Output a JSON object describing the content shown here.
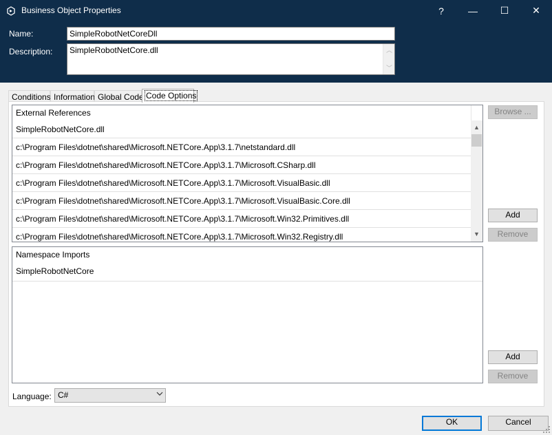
{
  "window": {
    "title": "Business Object Properties",
    "controls": {
      "help": "?",
      "minimize": "—",
      "maximize": "☐",
      "close": "✕"
    }
  },
  "fields": {
    "name_label": "Name:",
    "name_value": "SimpleRobotNetCoreDll",
    "description_label": "Description:",
    "description_value": "SimpleRobotNetCore.dll"
  },
  "tabs": [
    "Conditions",
    "Information",
    "Global Code",
    "Code Options"
  ],
  "active_tab": "Code Options",
  "external_references": {
    "header": "External References",
    "items": [
      "SimpleRobotNetCore.dll",
      "c:\\Program Files\\dotnet\\shared\\Microsoft.NETCore.App\\3.1.7\\netstandard.dll",
      "c:\\Program Files\\dotnet\\shared\\Microsoft.NETCore.App\\3.1.7\\Microsoft.CSharp.dll",
      "c:\\Program Files\\dotnet\\shared\\Microsoft.NETCore.App\\3.1.7\\Microsoft.VisualBasic.dll",
      "c:\\Program Files\\dotnet\\shared\\Microsoft.NETCore.App\\3.1.7\\Microsoft.VisualBasic.Core.dll",
      "c:\\Program Files\\dotnet\\shared\\Microsoft.NETCore.App\\3.1.7\\Microsoft.Win32.Primitives.dll",
      "c:\\Program Files\\dotnet\\shared\\Microsoft.NETCore.App\\3.1.7\\Microsoft.Win32.Registry.dll"
    ],
    "browse_label": "Browse ...",
    "add_label": "Add",
    "remove_label": "Remove"
  },
  "namespace_imports": {
    "header": "Namespace Imports",
    "items": [
      "SimpleRobotNetCore"
    ],
    "add_label": "Add",
    "remove_label": "Remove"
  },
  "language": {
    "label": "Language:",
    "selected": "C#"
  },
  "footer": {
    "ok_label": "OK",
    "cancel_label": "Cancel"
  },
  "colors": {
    "header_bg": "#0f2d4a",
    "accent": "#0078d7"
  }
}
